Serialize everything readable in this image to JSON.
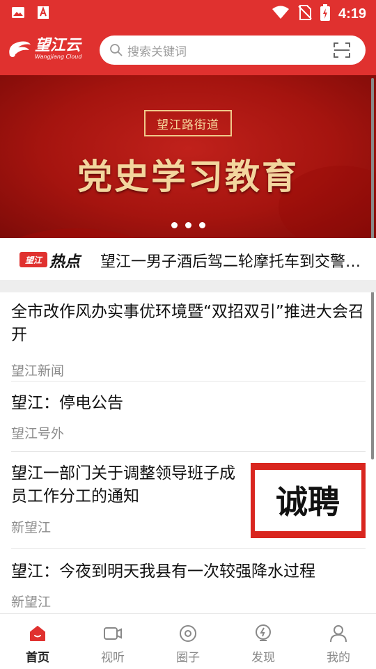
{
  "status_bar": {
    "time": "4:19",
    "left_icons": [
      "gallery-icon",
      "font-icon"
    ],
    "right_icons": [
      "wifi-icon",
      "no-sim-icon",
      "battery-charging-icon"
    ]
  },
  "header": {
    "logo_cn": "望江云",
    "logo_en": "Wangjiang Cloud",
    "search_placeholder": "搜索关键词"
  },
  "banner": {
    "tag": "望江路街道",
    "title": "党史学习教育",
    "page_count": 3,
    "active_page": 1
  },
  "hot": {
    "badge": "望江",
    "label": "热点",
    "headline": "望江一男子酒后驾二轮摩托车到交警队..."
  },
  "news": [
    {
      "title": "全市改作风办实事优环境暨“双招双引”推进大会召开",
      "source": "望江新闻"
    },
    {
      "title": "望江：停电公告",
      "source": "望江号外"
    },
    {
      "title": "望江一部门关于调整领导班子成员工作分工的通知",
      "source": "新望江",
      "thumb_text": "诚聘"
    },
    {
      "title": "望江：今夜到明天我县有一次较强降水过程",
      "source": "新望江"
    }
  ],
  "tabs": [
    {
      "label": "首页",
      "icon": "home-icon",
      "active": true
    },
    {
      "label": "视听",
      "icon": "video-icon",
      "active": false
    },
    {
      "label": "圈子",
      "icon": "circle-icon",
      "active": false
    },
    {
      "label": "发现",
      "icon": "discover-icon",
      "active": false
    },
    {
      "label": "我的",
      "icon": "profile-icon",
      "active": false
    }
  ],
  "colors": {
    "brand_red": "#e0312f",
    "banner_gold": "#f3d69e"
  }
}
